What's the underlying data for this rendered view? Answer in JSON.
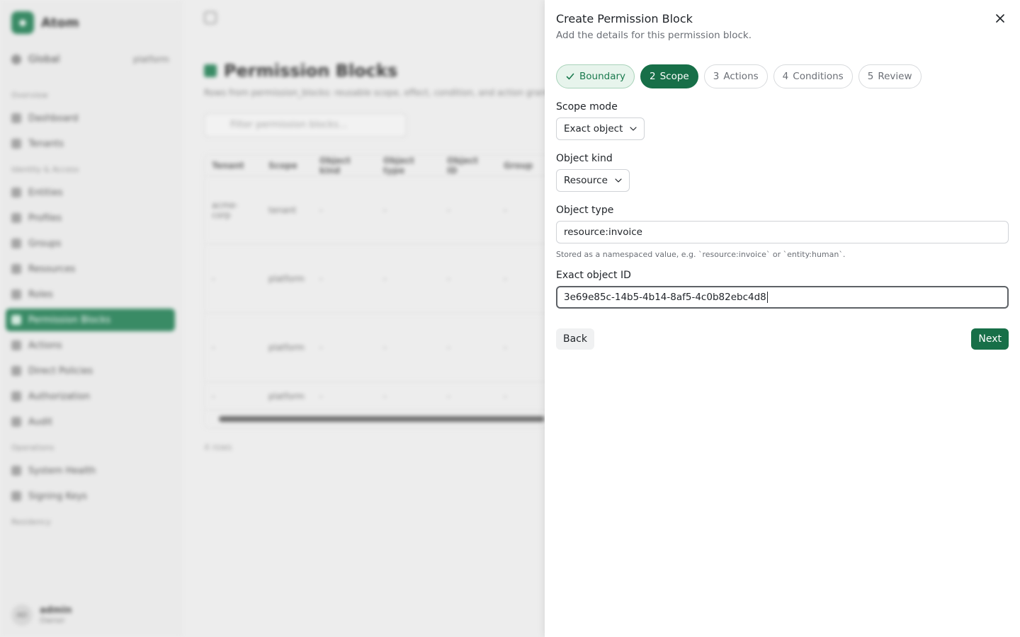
{
  "background": {
    "brand": "Atom",
    "scope_label": "Global",
    "scope_value": "platform",
    "nav": {
      "overview": "Overview",
      "dashboard": "Dashboard",
      "tenants": "Tenants",
      "identity": "Identity & Access",
      "entities": "Entities",
      "profiles": "Profiles",
      "groups": "Groups",
      "resources": "Resources",
      "roles": "Roles",
      "permission_blocks": "Permission Blocks",
      "actions": "Actions",
      "direct_policies": "Direct Policies",
      "authorization": "Authorization",
      "audit": "Audit",
      "operations": "Operations",
      "system_health": "System Health",
      "signing_keys": "Signing Keys",
      "residency": "Residency"
    },
    "user": {
      "name": "admin",
      "role": "Owner",
      "initials": "AD"
    },
    "page_title": "Permission Blocks",
    "page_desc": "Rows from permission_blocks: reusable scope, effect, condition, and action grants.",
    "filter_placeholder": "Filter permission blocks...",
    "table": {
      "headers": [
        "Tenant",
        "Scope",
        "Object kind",
        "Object type",
        "Object ID",
        "Group"
      ],
      "rows": [
        [
          "acme-corp",
          "tenant",
          "-",
          "-",
          "-",
          "-"
        ],
        [
          "-",
          "platform",
          "-",
          "-",
          "-",
          "-"
        ],
        [
          "-",
          "platform",
          "-",
          "-",
          "-",
          "-"
        ],
        [
          "-",
          "platform",
          "-",
          "-",
          "-",
          "-"
        ]
      ]
    },
    "count": "4 rows"
  },
  "modal": {
    "title": "Create Permission Block",
    "subtitle": "Add the details for this permission block.",
    "steps": [
      {
        "num": "",
        "label": "Boundary",
        "state": "done"
      },
      {
        "num": "2",
        "label": "Scope",
        "state": "current"
      },
      {
        "num": "3",
        "label": "Actions",
        "state": "pending"
      },
      {
        "num": "4",
        "label": "Conditions",
        "state": "pending"
      },
      {
        "num": "5",
        "label": "Review",
        "state": "pending"
      }
    ],
    "scope_mode": {
      "label": "Scope mode",
      "value": "Exact object"
    },
    "object_kind": {
      "label": "Object kind",
      "value": "Resource"
    },
    "object_type": {
      "label": "Object type",
      "value": "resource:invoice",
      "hint": "Stored as a namespaced value, e.g. `resource:invoice` or `entity:human`."
    },
    "object_id": {
      "label": "Exact object ID",
      "value": "3e69e85c-14b5-4b14-8af5-4c0b82ebc4d8"
    },
    "back_label": "Back",
    "next_label": "Next"
  },
  "colors": {
    "accent": "#176f48",
    "done_bg": "#e7f4ec"
  }
}
